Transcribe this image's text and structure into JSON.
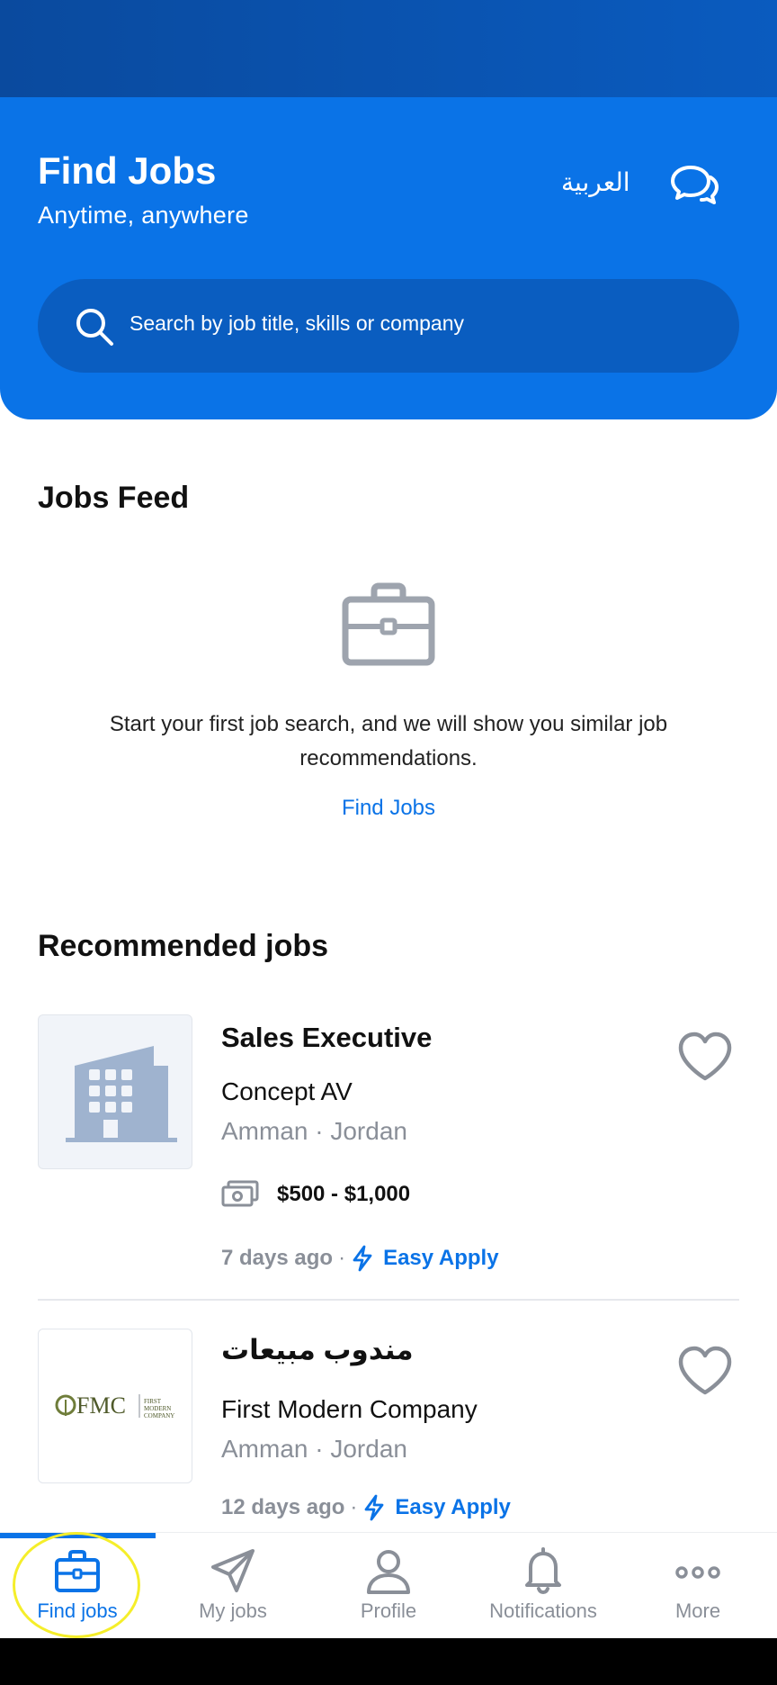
{
  "colors": {
    "primary": "#0a73e7",
    "muted": "#8a8f98",
    "highlight": "#f5ee2a"
  },
  "header": {
    "title": "Find Jobs",
    "subtitle": "Anytime, anywhere",
    "language_label": "العربية",
    "chat_icon": "chat-bubbles-icon"
  },
  "search": {
    "placeholder": "Search by job title, skills or company",
    "icon": "search-icon"
  },
  "jobs_feed": {
    "title": "Jobs Feed",
    "icon": "briefcase-icon",
    "empty_message": "Start your first job search, and we will show you similar job recommendations.",
    "link_label": "Find Jobs"
  },
  "recommended": {
    "title": "Recommended jobs",
    "jobs": [
      {
        "title": "Sales Executive",
        "company": "Concept AV",
        "location": "Amman · Jordan",
        "salary": "$500 - $1,000",
        "posted": "7 days ago",
        "apply_label": "Easy Apply",
        "logo": "building-icon"
      },
      {
        "title": "مندوب مبيعات",
        "company": "First Modern Company",
        "location": "Amman · Jordan",
        "posted": "12 days ago",
        "apply_label": "Easy Apply",
        "logo_text": "FMC",
        "logo_subtext": "FIRST MODERN COMPANY"
      }
    ]
  },
  "tabs": [
    {
      "label": "Find jobs",
      "icon": "briefcase-icon",
      "active": true
    },
    {
      "label": "My jobs",
      "icon": "paper-plane-icon",
      "active": false
    },
    {
      "label": "Profile",
      "icon": "person-icon",
      "active": false
    },
    {
      "label": "Notifications",
      "icon": "bell-icon",
      "active": false
    },
    {
      "label": "More",
      "icon": "more-dots-icon",
      "active": false
    }
  ]
}
